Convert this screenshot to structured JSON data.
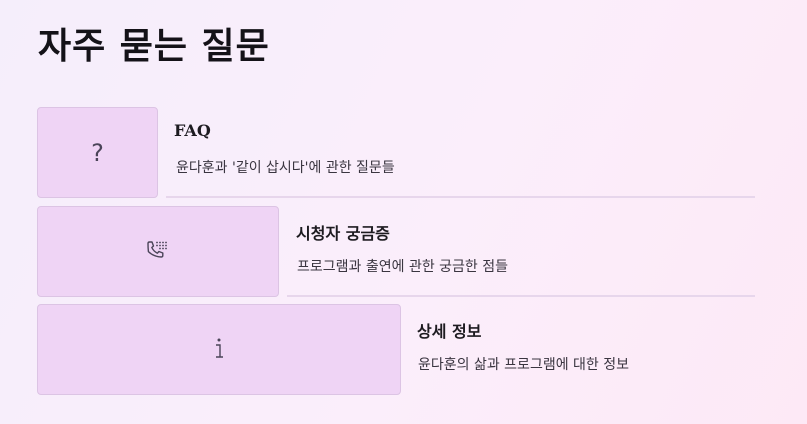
{
  "page": {
    "title": "자주 묻는 질문"
  },
  "faq_items": [
    {
      "title": "FAQ",
      "description": "윤다훈과 '같이 삽시다'에 관한 질문들",
      "icon": "question-mark-icon"
    },
    {
      "title": "시청자 궁금증",
      "description": "프로그램과 출연에 관한 궁금한 점들",
      "icon": "dialpad-phone-icon"
    },
    {
      "title": "상세 정보",
      "description": "윤다훈의 삶과 프로그램에 대한 정보",
      "icon": "info-icon"
    }
  ],
  "colors": {
    "tile_background": "#efd4f5",
    "tile_border": "#dcc4e4",
    "divider": "#e7d6ec",
    "title_text": "#141218"
  }
}
